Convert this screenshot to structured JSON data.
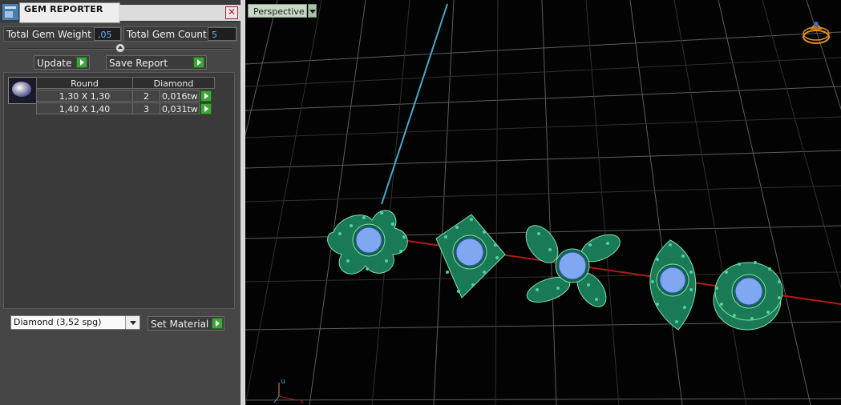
{
  "window": {
    "title": "GEM REPORTER",
    "close_icon": "close-icon"
  },
  "totals": {
    "weight_label": "Total Gem Weight",
    "weight_value": ",05",
    "count_label": "Total Gem Count",
    "count_value": "5"
  },
  "actions": {
    "update_label": "Update",
    "save_report_label": "Save Report"
  },
  "gem_table": {
    "shape": "Round",
    "material": "Diamond",
    "rows": [
      {
        "size": "1,30 X 1,30",
        "count": "2",
        "weight": "0,016tw"
      },
      {
        "size": "1,40 X 1,40",
        "count": "3",
        "weight": "0,031tw"
      }
    ]
  },
  "material_selector": {
    "selected": "Diamond     (3,52 spg)",
    "set_label": "Set Material"
  },
  "viewport": {
    "view_name": "Perspective",
    "axis_labels": {
      "up": "u",
      "right": "x"
    }
  },
  "colors": {
    "accent_green": "#3fa53a",
    "value_blue": "#67b0ff",
    "model_green": "#1a7a55",
    "gem_blue": "#7fa8f0"
  }
}
